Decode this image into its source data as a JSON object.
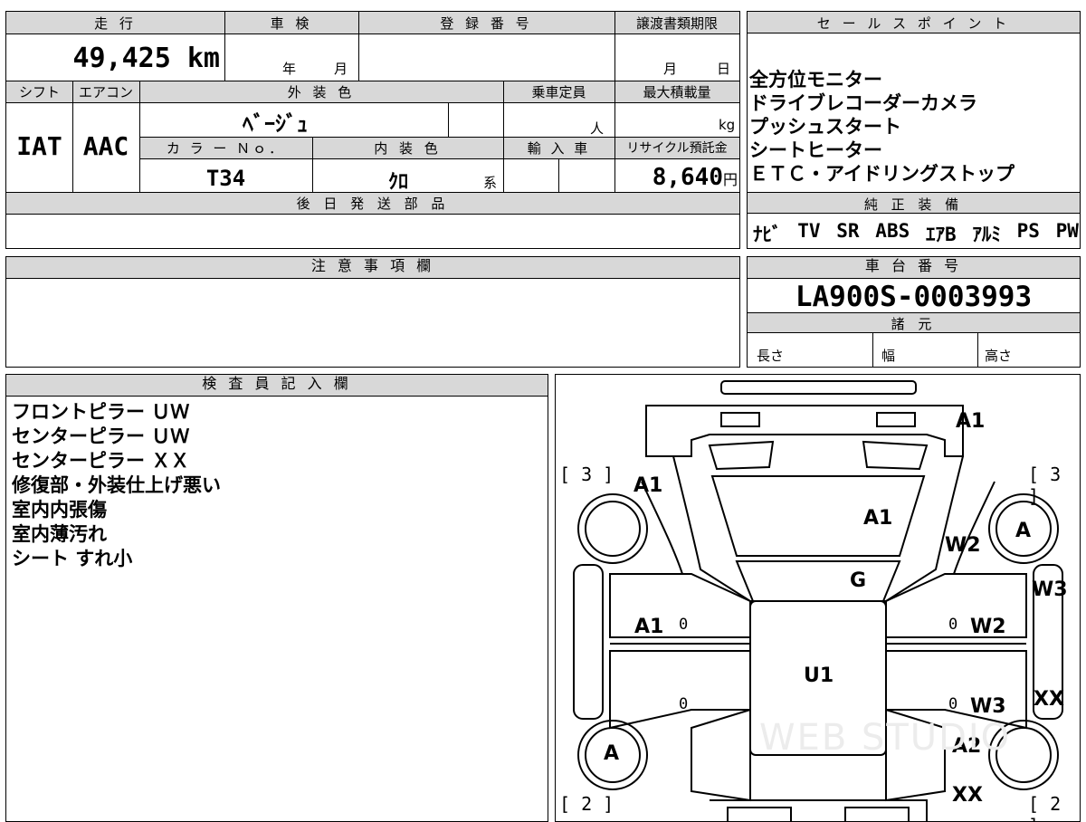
{
  "top": {
    "mileage_label": "走 行",
    "mileage": "49,425",
    "mileage_unit": "km",
    "shaken_label": "車 検",
    "year": "年",
    "month": "月",
    "reg_label": "登 録 番 号",
    "transfer_label": "譲渡書類期限",
    "t_month": "月",
    "t_day": "日",
    "shift_label": "シフト",
    "ac_label": "エアコン",
    "ext_label": "外 装 色",
    "capacity_label": "乗車定員",
    "load_label": "最大積載量",
    "shift": "IAT",
    "ac": "AAC",
    "ext_color": "ﾍﾞｰｼﾞｭ",
    "person": "人",
    "kg": "kg",
    "colorno_label": "カ ラ ー Ｎｏ．",
    "int_label": "内 装 色",
    "import_label": "輸 入 車",
    "recycle_label": "リサイクル預託金",
    "colorno": "T34",
    "int_color": "ｸﾛ",
    "kei": "系",
    "recycle": "8,640",
    "yen": "円",
    "parts_label": "後 日 発 送 部 品"
  },
  "sales": {
    "label": "セ ー ル ス ポ イ ン ト",
    "points": [
      "全方位モニター",
      "ドライブレコーダーカメラ",
      "プッシュスタート",
      "シートヒーター",
      "ＥＴＣ・アイドリングストップ"
    ],
    "equip_label": "純 正 装 備",
    "equip": [
      "ﾅﾋﾞ",
      "TV",
      "SR",
      "ABS",
      "ｴｱB",
      "ｱﾙﾐ",
      "PS",
      "PW"
    ]
  },
  "notes": {
    "label": "注 意 事 項 欄"
  },
  "chassis": {
    "label": "車 台 番 号",
    "number": "LA900S-0003993",
    "spec_label": "諸 元",
    "length": "長さ",
    "width": "幅",
    "height": "高さ"
  },
  "inspector": {
    "label": "検 査 員 記 入 欄",
    "lines": [
      "フロントピラー ＵＷ",
      "センターピラー ＵＷ",
      "センターピラー ＸＸ",
      "修復部・外装仕上げ悪い",
      "室内内張傷",
      "室内薄汚れ",
      "シート すれ小"
    ]
  },
  "diagram": {
    "marks": {
      "front_bumper": "A1",
      "front_left_fender": "A1",
      "hood": "A1",
      "right_fender": "W2",
      "wheel_fr": "A",
      "windshield": "G",
      "left_front_door": "A1",
      "right_front_door": "W2",
      "right_step": "W3",
      "roof": "U1",
      "right_rear_door": "W3",
      "right_rear_step": "XX",
      "wheel_rl": "A",
      "right_quarter": "A2",
      "rear_right": "XX",
      "corner_tl": "[ 3 ]",
      "corner_tr": "[ 3 ]",
      "corner_bl": "[ 2 ]",
      "corner_br": "[ 2 ]",
      "zero": "0"
    },
    "watermark": "WEB STUDIO"
  }
}
